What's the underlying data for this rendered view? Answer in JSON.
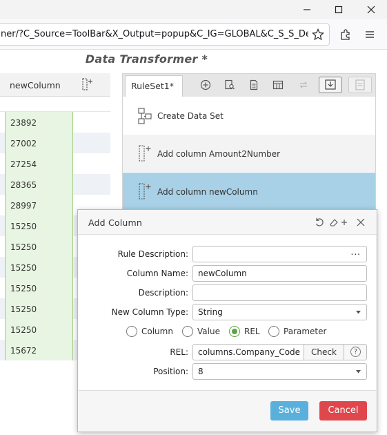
{
  "browser": {
    "url": "ner/?C_Source=ToolBar&X_Output=popup&C_IG=GLOBAL&C_S_S_Descr"
  },
  "app": {
    "title": "Data Transformer *"
  },
  "grid": {
    "column_header": "newColumn",
    "values": [
      "23892",
      "27002",
      "27254",
      "28365",
      "28997",
      "15250",
      "15250",
      "15250",
      "15250",
      "15250",
      "15250",
      "15672"
    ]
  },
  "ruleset": {
    "tab_label": "RuleSet1*",
    "toolbar_icons": [
      "add-circle-icon",
      "search-document-icon",
      "document-icon",
      "table-icon",
      "swap-icon",
      "import-icon",
      "clipboard-icon"
    ],
    "rules": [
      {
        "label": "Create Data Set",
        "icon": "create-dataset-icon"
      },
      {
        "label": "Add column Amount2Number",
        "icon": "add-column-icon"
      },
      {
        "label": "Add column newColumn",
        "icon": "add-column-icon",
        "selected": true
      }
    ],
    "selected_color": "#a8d0e6"
  },
  "dialog": {
    "title": "Add Column",
    "fields": {
      "rule_description": {
        "label": "Rule Description:",
        "value": "",
        "more": "..."
      },
      "column_name": {
        "label": "Column Name:",
        "value": "newColumn"
      },
      "description": {
        "label": "Description:",
        "value": ""
      },
      "new_column_type": {
        "label": "New Column Type:",
        "value": "String"
      },
      "rel": {
        "label": "REL:",
        "value": "columns.Company_Code",
        "check_label": "Check",
        "help": "?"
      },
      "position": {
        "label": "Position:",
        "value": "8"
      }
    },
    "source_options": [
      "Column",
      "Value",
      "REL",
      "Parameter"
    ],
    "source_selected": "REL",
    "save_label": "Save",
    "cancel_label": "Cancel",
    "save_color": "#5ab0dd",
    "cancel_color": "#e0474c"
  }
}
